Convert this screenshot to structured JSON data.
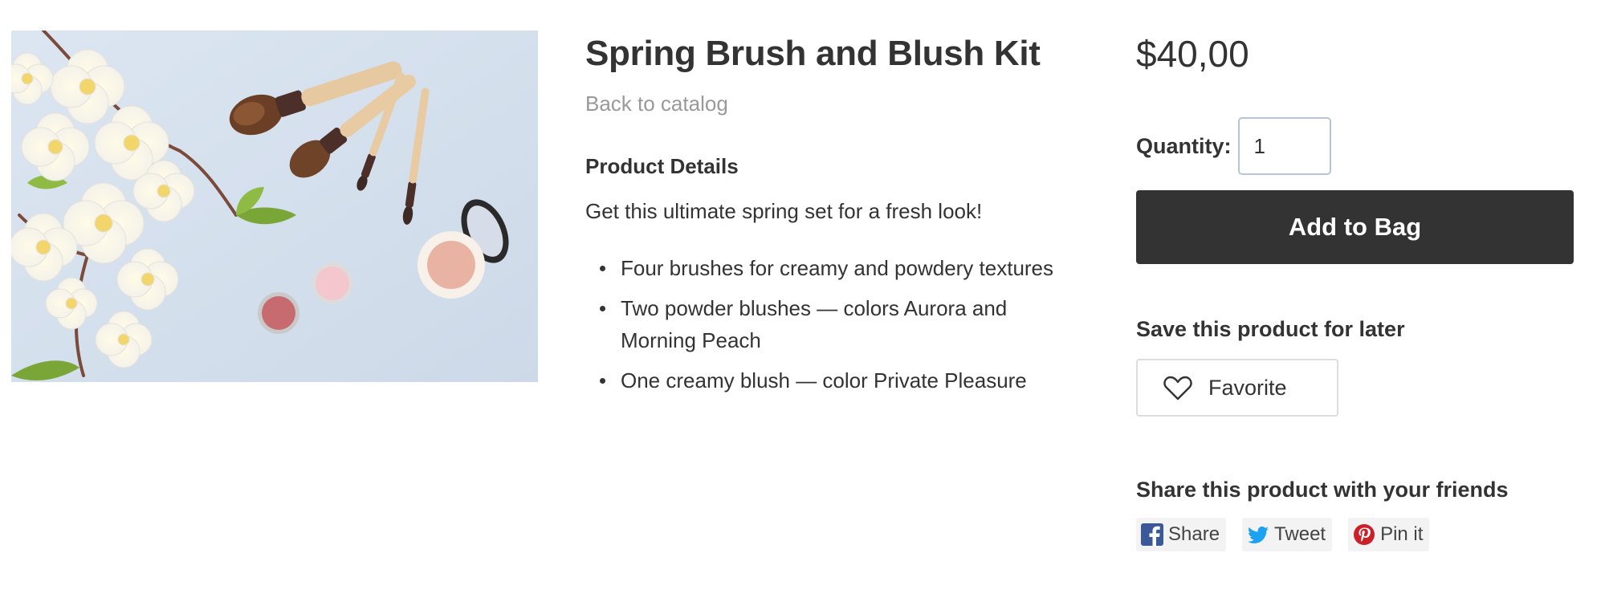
{
  "product": {
    "title": "Spring Brush and Blush Kit",
    "back_link": "Back to catalog",
    "image": {
      "depicts": [
        "white-flowers",
        "makeup-brushes",
        "blush-compact",
        "eyeshadow-pans"
      ],
      "background_color": "#d8e2ef"
    }
  },
  "details": {
    "heading": "Product Details",
    "description": "Get this ultimate spring set for a fresh look!",
    "features": [
      "Four brushes for creamy and powdery textures",
      "Two powder blushes — colors Aurora and Morning Peach",
      "One creamy blush — color Private Pleasure"
    ]
  },
  "purchase": {
    "price": "$40,00",
    "quantity_label": "Quantity:",
    "quantity_value": "1",
    "add_button": "Add to Bag"
  },
  "save": {
    "heading": "Save this product for later",
    "favorite_label": "Favorite",
    "favorite_icon": "heart-icon"
  },
  "share": {
    "heading": "Share this product with your friends",
    "buttons": [
      {
        "label": "Share",
        "icon": "facebook-icon",
        "color": "#3b5998"
      },
      {
        "label": "Tweet",
        "icon": "twitter-icon",
        "color": "#1da1f2"
      },
      {
        "label": "Pin it",
        "icon": "pinterest-icon",
        "color": "#cb2027"
      }
    ]
  },
  "colors": {
    "text": "#333333",
    "muted": "#999999",
    "button_dark": "#333333",
    "input_border": "#b7c3d6"
  }
}
